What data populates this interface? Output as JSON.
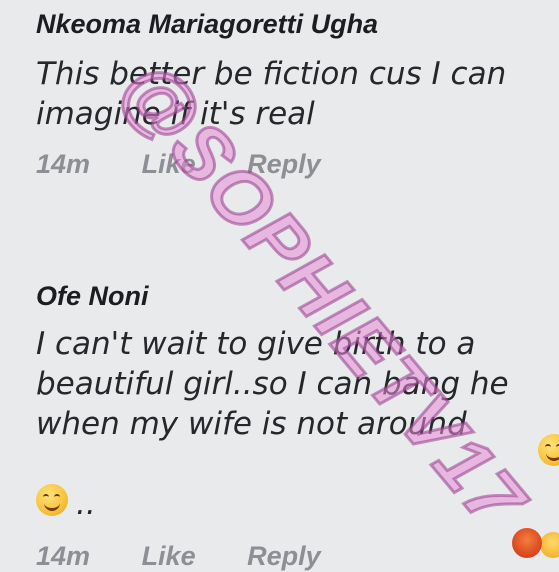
{
  "comments": [
    {
      "author": "Nkeoma Mariagoretti Ugha",
      "lines": [
        "This better be fiction cus I can",
        "imagine if it's real"
      ],
      "time": "14m",
      "like_label": "Like",
      "reply_label": "Reply"
    },
    {
      "author": "Ofe Noni",
      "lines": [
        "I can't wait to give birth to a",
        "beautiful girl..so I can bang he",
        "when my wife is not around"
      ],
      "emoji_suffix": "..",
      "time": "14m",
      "like_label": "Like",
      "reply_label": "Reply"
    }
  ],
  "watermark": "@SOPHIETV17",
  "icons": {
    "inline_emoji": "grinning-face-icon",
    "line_emoji": "smiling-face-icon",
    "reaction_1": "angry-reaction-icon",
    "reaction_2": "haha-reaction-icon"
  },
  "colors": {
    "background": "#e9eaec",
    "author": "#1c1d20",
    "text": "#26272b",
    "meta": "#8d8f94",
    "watermark": "#e68cd7"
  }
}
